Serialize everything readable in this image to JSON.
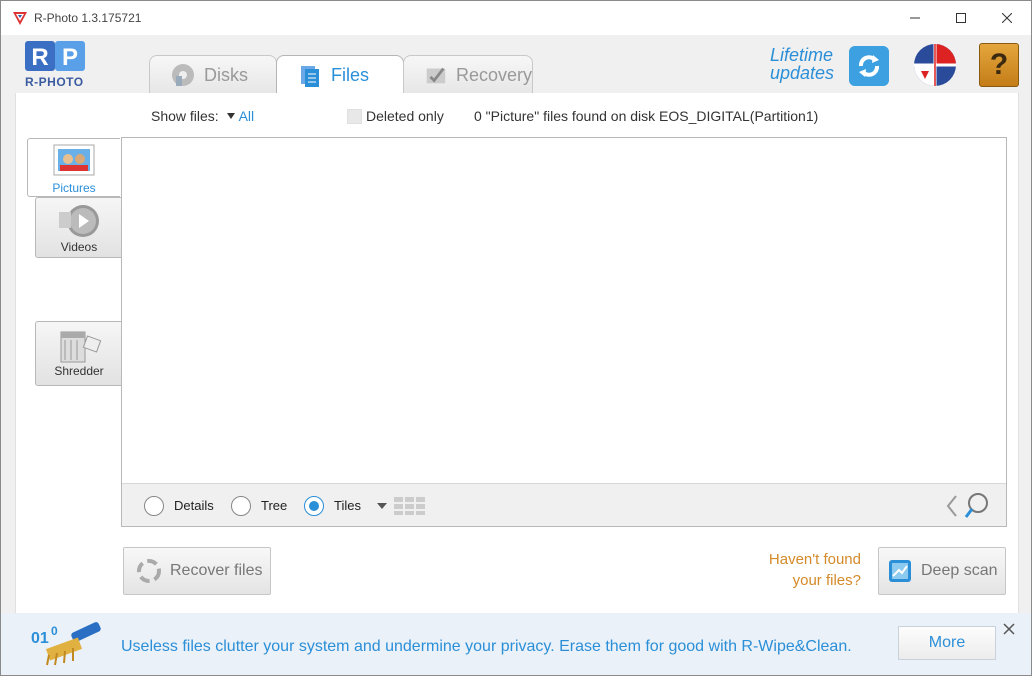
{
  "window": {
    "title": "R-Photo 1.3.175721"
  },
  "logo": {
    "text": "R-PHOTO"
  },
  "tabs": [
    {
      "label": "Disks",
      "icon": "disk-icon",
      "active": false
    },
    {
      "label": "Files",
      "icon": "files-icon",
      "active": true
    },
    {
      "label": "Recovery",
      "icon": "recovery-icon",
      "active": false
    }
  ],
  "updates": {
    "line1": "Lifetime",
    "line2": "updates"
  },
  "toolbar": {
    "show_files_label": "Show files:",
    "show_files_value": "All",
    "deleted_only_label": "Deleted only",
    "status_text": "0 \"Picture\" files found on disk EOS_DIGITAL(Partition1)"
  },
  "side_nav": [
    {
      "label": "Pictures",
      "active": true
    },
    {
      "label": "Videos",
      "active": false
    },
    {
      "label": "Shredder",
      "active": false
    }
  ],
  "view_modes": [
    {
      "label": "Details",
      "checked": false
    },
    {
      "label": "Tree",
      "checked": false
    },
    {
      "label": "Tiles",
      "checked": true
    }
  ],
  "buttons": {
    "recover_files": "Recover files",
    "deep_scan": "Deep scan",
    "havent_line1": "Haven't found",
    "havent_line2": "your files?"
  },
  "ad": {
    "text": "Useless files clutter your system and undermine your privacy. Erase them for good with R-Wipe&Clean.",
    "more_label": "More"
  },
  "colors": {
    "accent": "#2b8fd8",
    "orange": "#d48a2a"
  }
}
